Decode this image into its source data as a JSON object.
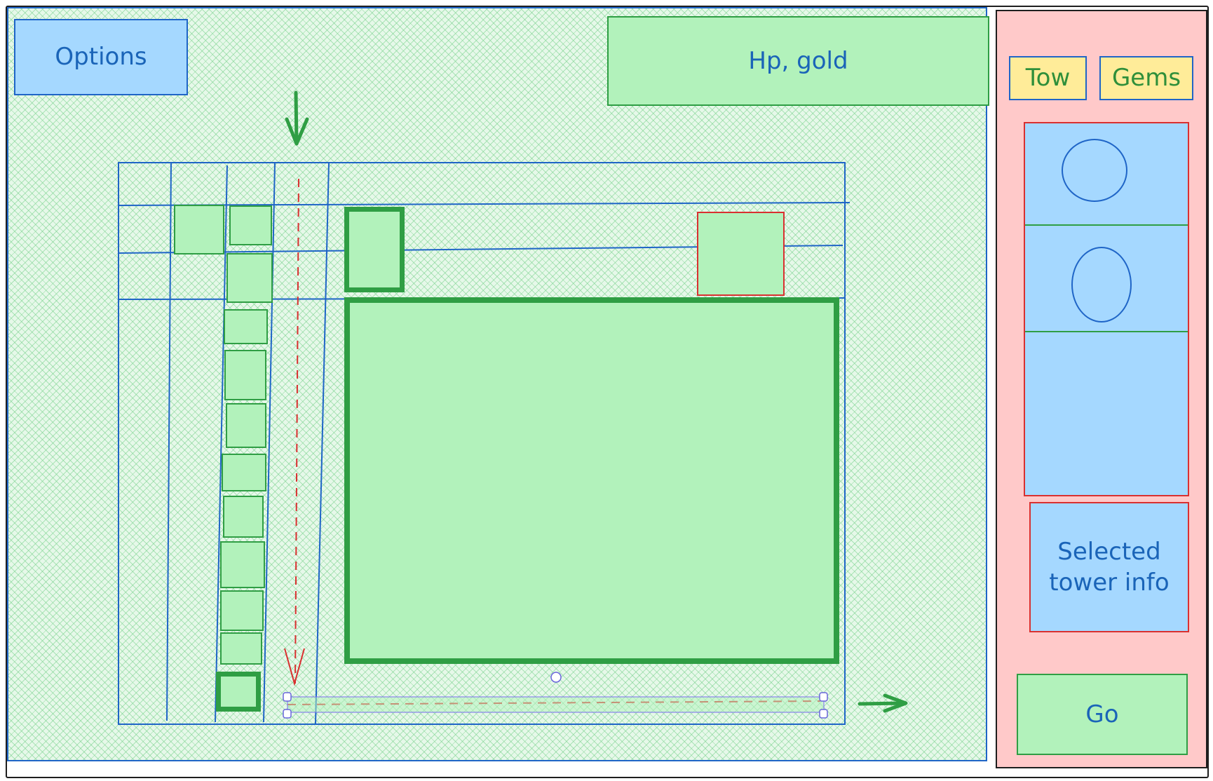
{
  "options": {
    "label": "Options"
  },
  "hud": {
    "label": "Hp, gold"
  },
  "sidebar": {
    "tabs": [
      {
        "label": "Tow"
      },
      {
        "label": "Gems"
      }
    ],
    "tower_info_label": "Selected\ntower info",
    "go_label": "Go"
  },
  "colors": {
    "blue_fill": "#a5d8ff",
    "green_fill": "#b2f2bb",
    "pink_fill": "#ffc9c9",
    "yellow_fill": "#ffec99",
    "blue_stroke": "#1f65c7",
    "green_stroke": "#2f9e44",
    "red_stroke": "#d93030"
  },
  "icons": [
    "arrow-down-icon",
    "arrow-right-icon",
    "tower-circle-icon",
    "selection-handle-icon"
  ]
}
